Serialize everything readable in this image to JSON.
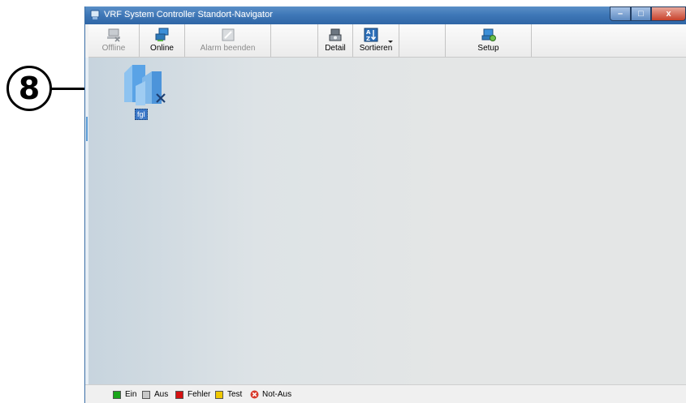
{
  "callout": {
    "number": "8"
  },
  "window": {
    "title": "VRF System Controller Standort-Navigator"
  },
  "window_controls": {
    "minimize": "–",
    "maximize": "□",
    "close": "x"
  },
  "toolbar": {
    "offline_label": "Offline",
    "online_label": "Online",
    "alarm_label": "Alarm beenden",
    "detail_label": "Detail",
    "sort_label": "Sortieren",
    "setup_label": "Setup"
  },
  "sites": [
    {
      "label": "fgl"
    }
  ],
  "legend": {
    "items": [
      {
        "label": "Ein",
        "color": "#1aa51a"
      },
      {
        "label": "Aus",
        "color": "#c8c8c8"
      },
      {
        "label": "Fehler",
        "color": "#d41111"
      },
      {
        "label": "Test",
        "color": "#f0c800"
      },
      {
        "label": "Not-Aus",
        "color": "#d83a2c"
      }
    ]
  },
  "icons": {
    "app": "window-app-icon",
    "offline": "computer-disconnect-icon",
    "online": "computer-connect-icon",
    "alarm": "alarm-stop-icon",
    "detail": "detail-icon",
    "sort": "sort-az-icon",
    "setup": "setup-computer-icon",
    "site": "building-icon"
  }
}
